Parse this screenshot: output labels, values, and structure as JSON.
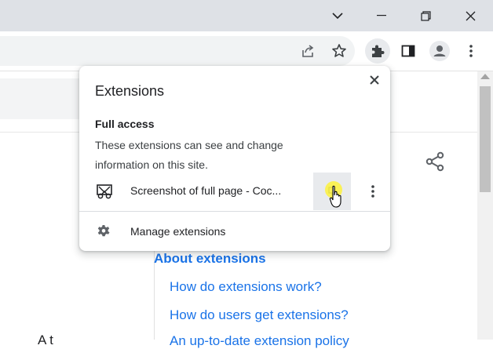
{
  "titlebar": {
    "buttons": [
      "chevron-down",
      "minimize",
      "restore",
      "close"
    ]
  },
  "toolbar": {
    "icons": [
      "share-icon",
      "star-icon",
      "puzzle-icon",
      "side-panel-icon",
      "profile-icon",
      "kebab-menu-icon"
    ]
  },
  "popup": {
    "title": "Extensions",
    "section_title": "Full access",
    "section_desc": "These extensions can see and change information on this site.",
    "extension": {
      "name": "Screenshot of full page - Coc..."
    },
    "manage_label": "Manage extensions"
  },
  "page": {
    "heading": "About extensions",
    "links": [
      "How do extensions work?",
      "How do users get extensions?",
      "An up-to-date extension policy"
    ],
    "cut_text": "A t"
  },
  "colors": {
    "titlebar": "#dee1e6",
    "link": "#1a73e8",
    "cursor_highlight": "#fdf23c"
  }
}
